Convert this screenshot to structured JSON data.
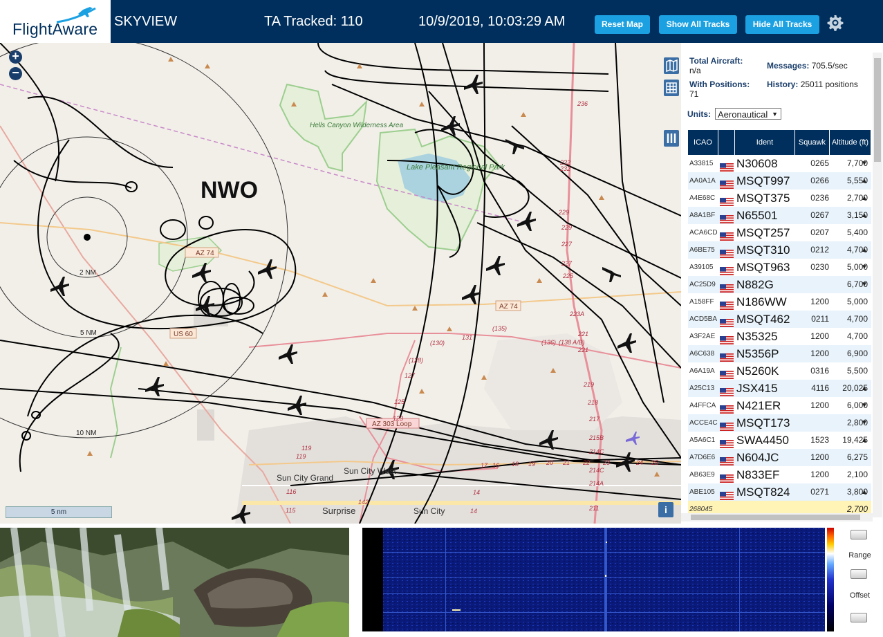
{
  "header": {
    "logo_text": "FlightAware",
    "app_name": "SKYVIEW",
    "tracked": "TA Tracked: 110",
    "datetime": "10/9/2019, 10:03:29 AM",
    "buttons": [
      "Reset Map",
      "Show All Tracks",
      "Hide All Tracks"
    ],
    "settings_icon": "gear-icon"
  },
  "map": {
    "airport_label": "NWO",
    "range_labels": [
      "2 NM",
      "5 NM",
      "10 NM"
    ],
    "place_labels": [
      "Hells Canyon Wilderness Area",
      "Lake Pleasant Regional Park",
      "Sun City West",
      "Sun City Grand",
      "Surprise",
      "Sun City"
    ],
    "road_labels": [
      "AZ 74",
      "US 60",
      "AZ 303 Loop",
      "AZ 74"
    ],
    "road_numbers": [
      "236",
      "232",
      "232",
      "229",
      "229",
      "227",
      "227",
      "225",
      "223A",
      "221",
      "221",
      "219",
      "218",
      "217",
      "215B",
      "214C",
      "214C",
      "214A",
      "211",
      "(130)",
      "131",
      "(135)",
      "(136)",
      "(138 A/B)",
      "(128)",
      "127",
      "125",
      "123",
      "119",
      "119",
      "116",
      "115",
      "142",
      "14",
      "14",
      "17",
      "16",
      "18",
      "19",
      "20",
      "21",
      "22",
      "23",
      "24",
      "25",
      "26"
    ],
    "scale": "5 nm",
    "zoom_in": "+",
    "zoom_out": "−",
    "info": "i"
  },
  "panel": {
    "total_aircraft_label": "Total Aircraft:",
    "total_aircraft_value": "n/a",
    "with_positions_label": "With Positions:",
    "with_positions_value": "71",
    "messages_label": "Messages:",
    "messages_value": "705.5/sec",
    "history_label": "History:",
    "history_value": "25011 positions",
    "units_label": "Units:",
    "units_value": "Aeronautical",
    "columns": [
      "ICAO",
      "",
      "Ident",
      "Squawk",
      "Altitude (ft)"
    ],
    "rows": [
      {
        "icao": "A33815",
        "ident": "N30608",
        "squawk": "0265",
        "alt": "7,700",
        "trend": "▼"
      },
      {
        "icao": "AA0A1A",
        "ident": "MSQT997",
        "squawk": "0266",
        "alt": "5,550",
        "trend": "▲"
      },
      {
        "icao": "A4E68C",
        "ident": "MSQT375",
        "squawk": "0236",
        "alt": "2,700",
        "trend": "▲"
      },
      {
        "icao": "A8A1BF",
        "ident": "N65501",
        "squawk": "0267",
        "alt": "3,150",
        "trend": "▲"
      },
      {
        "icao": "ACA6CD",
        "ident": "MSQT257",
        "squawk": "0207",
        "alt": "5,400",
        "trend": ""
      },
      {
        "icao": "A6BE75",
        "ident": "MSQT310",
        "squawk": "0212",
        "alt": "4,700",
        "trend": "▲"
      },
      {
        "icao": "A39105",
        "ident": "MSQT963",
        "squawk": "0230",
        "alt": "5,000",
        "trend": "▼"
      },
      {
        "icao": "AC25D9",
        "ident": "N882G",
        "squawk": "",
        "alt": "6,700",
        "trend": "▼"
      },
      {
        "icao": "A158FF",
        "ident": "N186WW",
        "squawk": "1200",
        "alt": "5,000",
        "trend": ""
      },
      {
        "icao": "ACD5BA",
        "ident": "MSQT462",
        "squawk": "0211",
        "alt": "4,700",
        "trend": ""
      },
      {
        "icao": "A3F2AE",
        "ident": "N35325",
        "squawk": "1200",
        "alt": "4,700",
        "trend": ""
      },
      {
        "icao": "A6C638",
        "ident": "N5356P",
        "squawk": "1200",
        "alt": "6,900",
        "trend": ""
      },
      {
        "icao": "A6A19A",
        "ident": "N5260K",
        "squawk": "0316",
        "alt": "5,500",
        "trend": ""
      },
      {
        "icao": "A25C13",
        "ident": "JSX415",
        "squawk": "4116",
        "alt": "20,025",
        "trend": "▲"
      },
      {
        "icao": "A4FFCA",
        "ident": "N421ER",
        "squawk": "1200",
        "alt": "6,000",
        "trend": "▼"
      },
      {
        "icao": "ACCE4C",
        "ident": "MSQT173",
        "squawk": "",
        "alt": "2,800",
        "trend": "▼"
      },
      {
        "icao": "A5A6C1",
        "ident": "SWA4450",
        "squawk": "1523",
        "alt": "19,425",
        "trend": "▲"
      },
      {
        "icao": "A7D6E6",
        "ident": "N604JC",
        "squawk": "1200",
        "alt": "6,275",
        "trend": ""
      },
      {
        "icao": "AB63E9",
        "ident": "N833EF",
        "squawk": "1200",
        "alt": "2,100",
        "trend": ""
      },
      {
        "icao": "ABE105",
        "ident": "MSQT824",
        "squawk": "0271",
        "alt": "3,800",
        "trend": "▲"
      },
      {
        "icao": "268045",
        "ident": "",
        "squawk": "",
        "alt": "2,700",
        "trend": ""
      }
    ]
  },
  "spectrum": {
    "range_label": "Range",
    "offset_label": "Offset"
  },
  "colors": {
    "header_bg": "#002f5d",
    "button_bg": "#1ba1e2",
    "table_header_bg": "#002f5d"
  }
}
